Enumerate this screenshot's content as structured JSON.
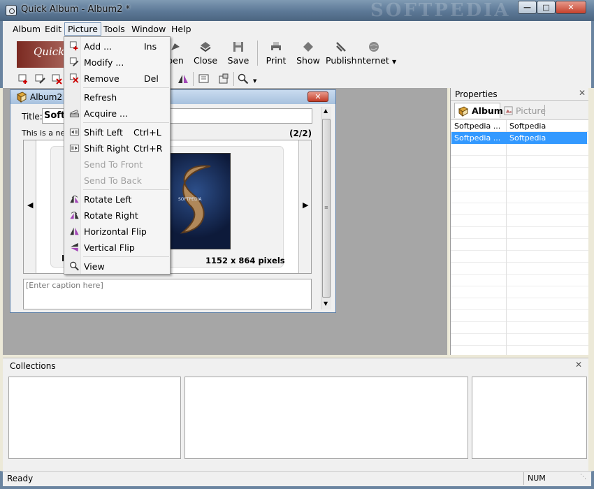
{
  "window": {
    "title": "Quick Album - Album2 *",
    "watermark": "SOFTPEDIA"
  },
  "menubar": [
    "Album",
    "Edit",
    "Picture",
    "Tools",
    "Window",
    "Help"
  ],
  "toolbar": {
    "logo": "Quick",
    "buttons": [
      "pen",
      "Close",
      "Save",
      "Print",
      "Show",
      "Publish",
      "Internet"
    ]
  },
  "document": {
    "title": "Album2 *",
    "title_label": "Title:",
    "title_value": "Softp",
    "description": "This is a new",
    "counter": "(2/2)",
    "dimensions": "1152 x 864 pixels",
    "image_label": "SOFTPEDIA",
    "caption_placeholder": "[Enter caption here]",
    "left_thumb_label": "P"
  },
  "picture_menu": [
    {
      "label": "Add ...",
      "key": "Ins",
      "icon": "add-picture-icon",
      "enabled": true
    },
    {
      "label": "Modify ...",
      "key": "",
      "icon": "modify-icon",
      "enabled": true
    },
    {
      "label": "Remove",
      "key": "Del",
      "icon": "remove-icon",
      "enabled": true
    },
    {
      "label": "Refresh",
      "key": "",
      "icon": "",
      "enabled": true
    },
    {
      "label": "Acquire ...",
      "key": "",
      "icon": "scanner-icon",
      "enabled": true
    },
    {
      "label": "Shift Left",
      "key": "Ctrl+L",
      "icon": "shift-left-icon",
      "enabled": true
    },
    {
      "label": "Shift Right",
      "key": "Ctrl+R",
      "icon": "shift-right-icon",
      "enabled": true
    },
    {
      "label": "Send To Front",
      "key": "",
      "icon": "",
      "enabled": false
    },
    {
      "label": "Send To Back",
      "key": "",
      "icon": "",
      "enabled": false
    },
    {
      "label": "Rotate Left",
      "key": "",
      "icon": "rotate-left-icon",
      "enabled": true
    },
    {
      "label": "Rotate Right",
      "key": "",
      "icon": "rotate-right-icon",
      "enabled": true
    },
    {
      "label": "Horizontal Flip",
      "key": "",
      "icon": "horizontal-flip-icon",
      "enabled": true
    },
    {
      "label": "Vertical Flip",
      "key": "",
      "icon": "vertical-flip-icon",
      "enabled": true
    },
    {
      "label": "View",
      "key": "",
      "icon": "magnifier-icon",
      "enabled": true
    }
  ],
  "properties": {
    "title": "Properties",
    "tabs": [
      "Album",
      "Picture"
    ],
    "rows": [
      {
        "name": "Softpedia ...",
        "value": "Softpedia"
      },
      {
        "name": "Softpedia ...",
        "value": "Softpedia"
      }
    ]
  },
  "collections": {
    "title": "Collections"
  },
  "status": {
    "text": "Ready",
    "num": "NUM"
  },
  "colors": {
    "selection": "#3399ff",
    "workspace": "#a6a6a6",
    "chrome": "#6a84a0"
  }
}
